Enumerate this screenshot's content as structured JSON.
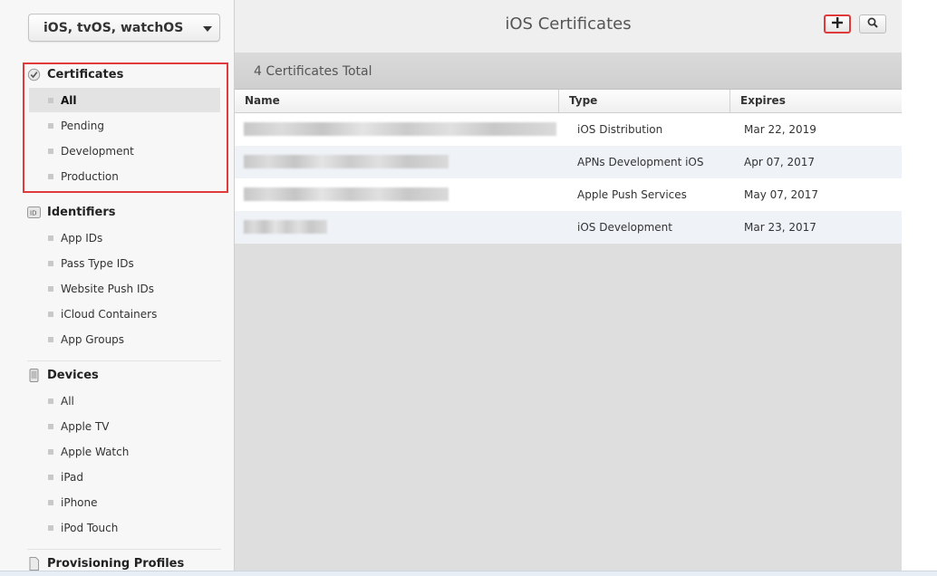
{
  "sidebar": {
    "platform_label": "iOS, tvOS, watchOS",
    "sections": {
      "certificates": {
        "title": "Certificates",
        "items": [
          "All",
          "Pending",
          "Development",
          "Production"
        ]
      },
      "identifiers": {
        "title": "Identifiers",
        "items": [
          "App IDs",
          "Pass Type IDs",
          "Website Push IDs",
          "iCloud Containers",
          "App Groups"
        ]
      },
      "devices": {
        "title": "Devices",
        "items": [
          "All",
          "Apple TV",
          "Apple Watch",
          "iPad",
          "iPhone",
          "iPod Touch"
        ]
      },
      "profiles": {
        "title": "Provisioning Profiles"
      }
    },
    "selected_item": "All"
  },
  "header": {
    "title": "iOS Certificates",
    "add_icon": "plus-icon",
    "search_icon": "search-icon"
  },
  "summary": {
    "count_text": "4 Certificates Total"
  },
  "table": {
    "columns": [
      "Name",
      "Type",
      "Expires"
    ],
    "rows": [
      {
        "type": "iOS Distribution",
        "expires": "Mar 22, 2019"
      },
      {
        "type": "APNs Development iOS",
        "expires": "Apr 07, 2017"
      },
      {
        "type": "Apple Push Services",
        "expires": "May 07, 2017"
      },
      {
        "type": "iOS Development",
        "expires": "Mar 23, 2017"
      }
    ]
  },
  "colors": {
    "highlight": "#e03a3a",
    "row_alt": "#eff3f8",
    "sidebar_bg": "#f7f7f7",
    "main_bg": "#dedede"
  }
}
